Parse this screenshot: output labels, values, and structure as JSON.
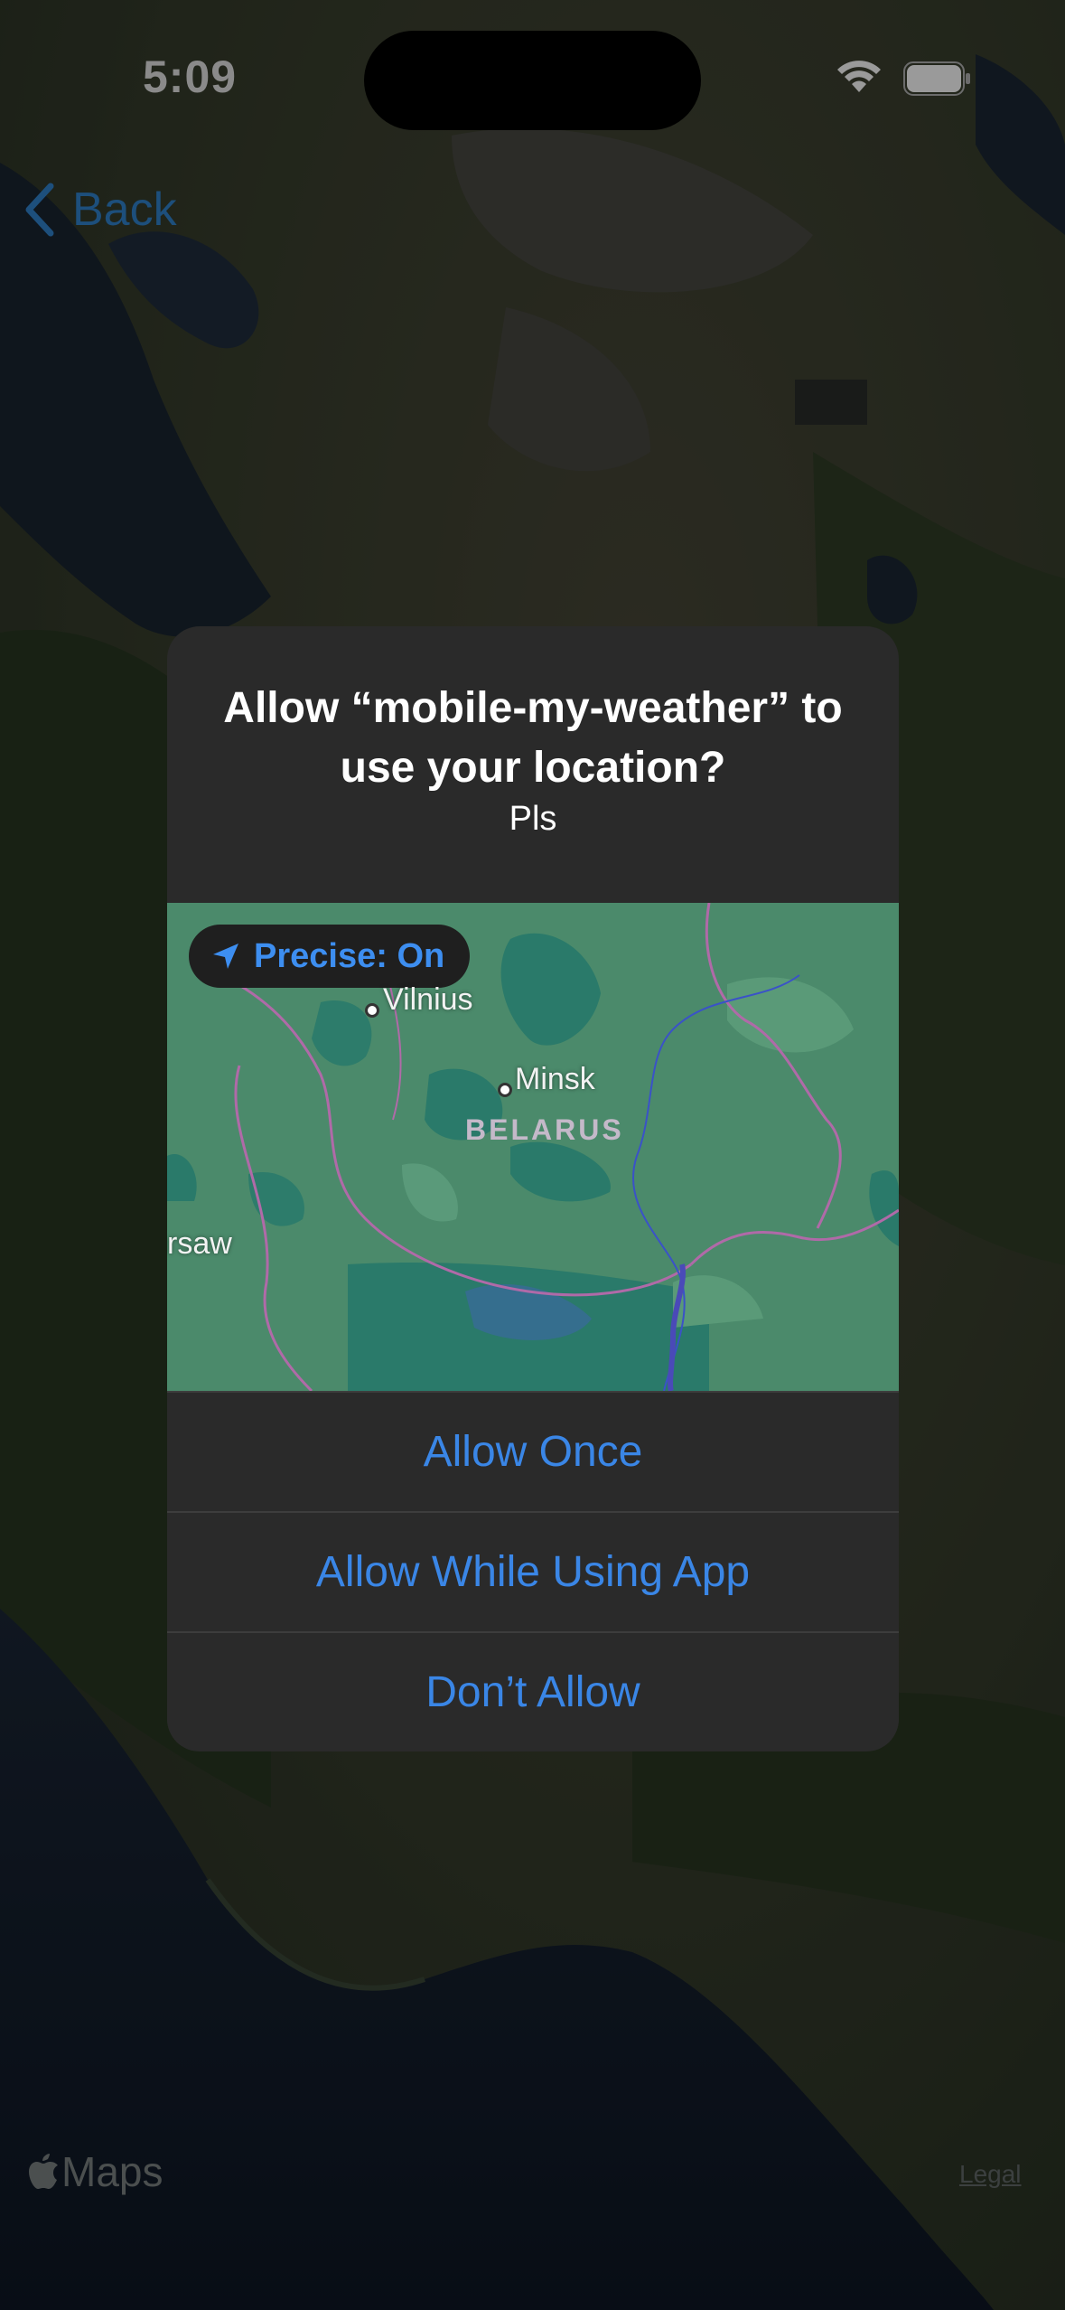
{
  "status_bar": {
    "time": "5:09",
    "icons": [
      "wifi-icon",
      "battery-icon"
    ]
  },
  "nav": {
    "back_label": "Back",
    "back_icon": "chevron-left-icon"
  },
  "map_attribution": {
    "logo_text": "Maps",
    "legal_label": "Legal"
  },
  "alert": {
    "title": "Allow “mobile-my-weather” to use your location?",
    "message": "Pls",
    "precise_label": "Precise: On",
    "precise_icon": "location-arrow-icon",
    "map_labels": {
      "city_1": "Vilnius",
      "city_2": "Minsk",
      "city_3": "rsaw",
      "country": "BELARUS"
    },
    "buttons": {
      "allow_once": "Allow Once",
      "allow_while_using": "Allow While Using App",
      "dont_allow": "Don’t Allow"
    }
  },
  "colors": {
    "accent": "#3a86e6",
    "alert_bg": "#2a2a2a",
    "map_water": "#4a8a6c",
    "pill_text": "#3d8ef0"
  }
}
